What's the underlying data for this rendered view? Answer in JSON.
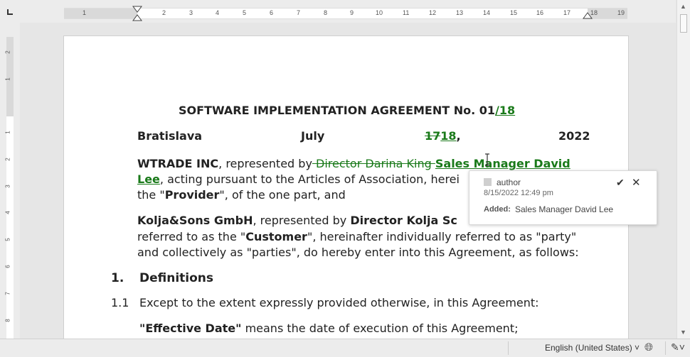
{
  "ruler": {
    "corner": "tab-stop-left-icon",
    "top_numbers": [
      "1",
      "1",
      "2",
      "3",
      "4",
      "5",
      "6",
      "7",
      "8",
      "9",
      "10",
      "11",
      "12",
      "13",
      "14",
      "15",
      "16",
      "17",
      "18",
      "19"
    ],
    "left_numbers": [
      "2",
      "1",
      "1",
      "2",
      "3",
      "4",
      "5",
      "6",
      "7",
      "8"
    ]
  },
  "document": {
    "title_main": "SOFTWARE IMPLEMENTATION AGREEMENT No. 01",
    "title_inserted": "/18",
    "line2": {
      "city": "Bratislava",
      "month": "July",
      "day_deleted": "17",
      "day_inserted": "18",
      "comma": ",",
      "year": "2022"
    },
    "para1": {
      "party": "WTRADE INC",
      "t1": ", represented by",
      "deleted": " Director Darina King ",
      "inserted_a": "Sales Manager David",
      "inserted_b": "Lee",
      "t2": ", acting pursuant to the Articles of Association, herei",
      "t3": "the \"",
      "provider": "Provider",
      "t4": "\", of the one part, and"
    },
    "para2": {
      "party": "Kolja&Sons GmbH",
      "t1": ", represented by ",
      "director": "Director Kolja Sc",
      "l2a": "referred to as the \"",
      "customer": "Customer",
      "l2b": "\", hereinafter individually referred to as \"party\"",
      "l3": "and collectively as \"parties\", do hereby enter into this Agreement, as follows:"
    },
    "section1": {
      "number": "1.",
      "title": "Definitions"
    },
    "clause11": {
      "number": "1.1",
      "text": "Except to the extent expressly provided otherwise, in this Agreement:"
    },
    "def1": {
      "term": "Effective Date",
      "q1": "\"",
      "q2": "\"",
      "rest": " means the date of execution of this Agreement;"
    }
  },
  "comment": {
    "author": "author",
    "date": "8/15/2022 12:49 pm",
    "added_label": "Added:",
    "added_value": "Sales Manager David Lee",
    "accept_icon": "check-icon",
    "reject_icon": "close-icon"
  },
  "statusbar": {
    "language": "English (United States) ˅",
    "globe_icon": "globe-icon",
    "track_icon": "track-changes-icon"
  },
  "colors": {
    "track_change": "#1a7a1a"
  }
}
